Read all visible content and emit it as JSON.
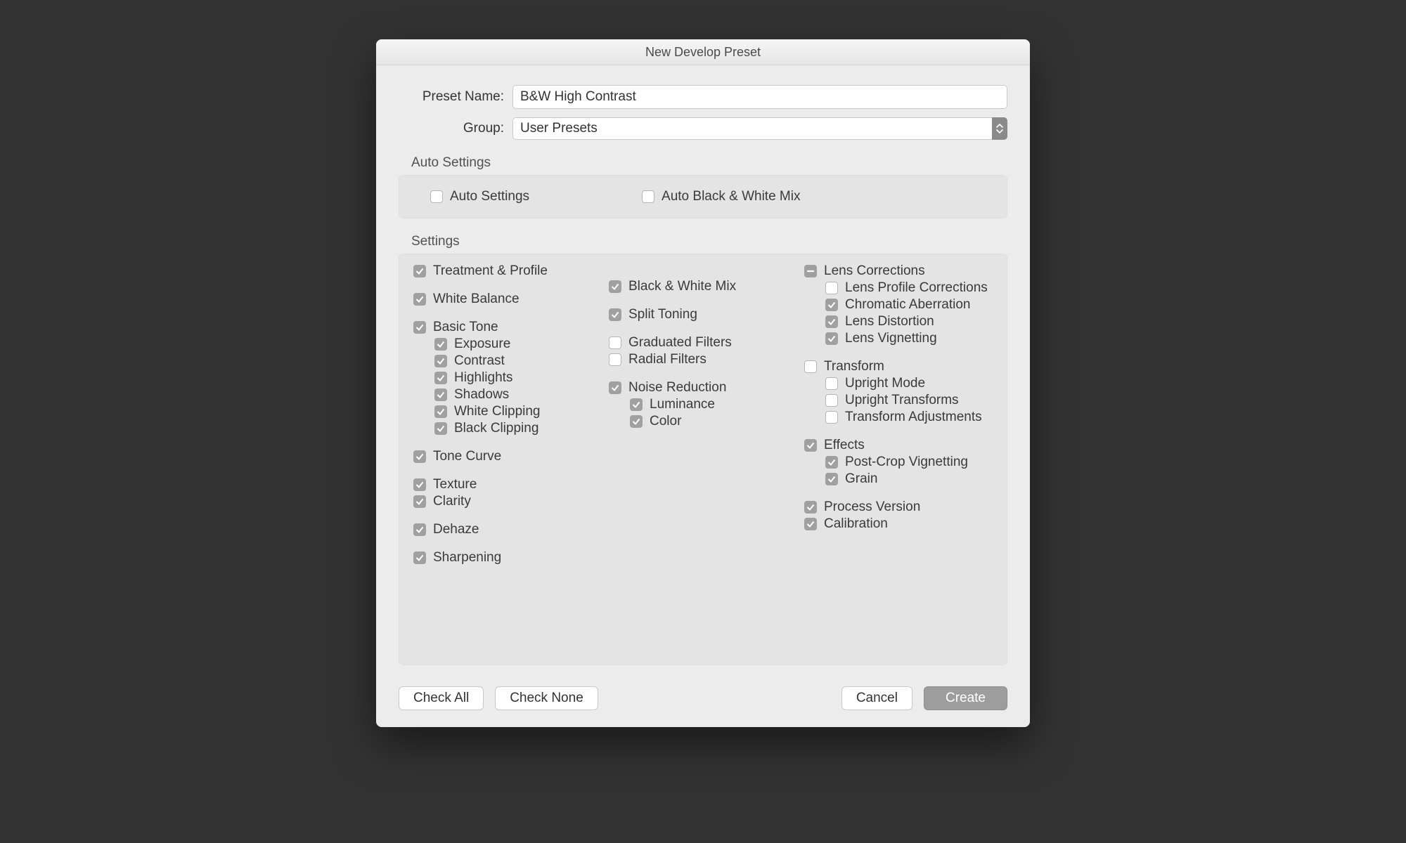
{
  "title": "New Develop Preset",
  "form": {
    "preset_name_label": "Preset Name:",
    "preset_name_value": "B&W High Contrast",
    "group_label": "Group:",
    "group_value": "User Presets"
  },
  "auto_section": {
    "header": "Auto Settings",
    "auto_settings": {
      "label": "Auto Settings",
      "checked": false
    },
    "auto_bw_mix": {
      "label": "Auto Black & White Mix",
      "checked": false
    }
  },
  "settings_section": {
    "header": "Settings"
  },
  "col1": {
    "treatment_profile": {
      "label": "Treatment & Profile",
      "checked": true
    },
    "white_balance": {
      "label": "White Balance",
      "checked": true
    },
    "basic_tone": {
      "label": "Basic Tone",
      "checked": true
    },
    "basic_tone_children": {
      "exposure": {
        "label": "Exposure",
        "checked": true
      },
      "contrast": {
        "label": "Contrast",
        "checked": true
      },
      "highlights": {
        "label": "Highlights",
        "checked": true
      },
      "shadows": {
        "label": "Shadows",
        "checked": true
      },
      "white_clipping": {
        "label": "White Clipping",
        "checked": true
      },
      "black_clipping": {
        "label": "Black Clipping",
        "checked": true
      }
    },
    "tone_curve": {
      "label": "Tone Curve",
      "checked": true
    },
    "texture": {
      "label": "Texture",
      "checked": true
    },
    "clarity": {
      "label": "Clarity",
      "checked": true
    },
    "dehaze": {
      "label": "Dehaze",
      "checked": true
    },
    "sharpening": {
      "label": "Sharpening",
      "checked": true
    }
  },
  "col2": {
    "bw_mix": {
      "label": "Black  &  White Mix",
      "checked": true
    },
    "split_toning": {
      "label": "Split Toning",
      "checked": true
    },
    "graduated_filters": {
      "label": "Graduated Filters",
      "checked": false
    },
    "radial_filters": {
      "label": "Radial Filters",
      "checked": false
    },
    "noise_reduction": {
      "label": "Noise Reduction",
      "checked": true
    },
    "noise_children": {
      "luminance": {
        "label": "Luminance",
        "checked": true
      },
      "color": {
        "label": "Color",
        "checked": true
      }
    }
  },
  "col3": {
    "lens_corrections": {
      "label": "Lens Corrections",
      "state": "mixed"
    },
    "lens_children": {
      "lens_profile": {
        "label": "Lens Profile Corrections",
        "checked": false
      },
      "chromatic": {
        "label": "Chromatic Aberration",
        "checked": true
      },
      "distortion": {
        "label": "Lens Distortion",
        "checked": true
      },
      "vignetting": {
        "label": "Lens Vignetting",
        "checked": true
      }
    },
    "transform": {
      "label": "Transform",
      "checked": false
    },
    "transform_children": {
      "upright_mode": {
        "label": "Upright Mode",
        "checked": false
      },
      "upright_transforms": {
        "label": "Upright Transforms",
        "checked": false
      },
      "transform_adjustments": {
        "label": "Transform Adjustments",
        "checked": false
      }
    },
    "effects": {
      "label": "Effects",
      "checked": true
    },
    "effects_children": {
      "post_crop_vignetting": {
        "label": "Post-Crop Vignetting",
        "checked": true
      },
      "grain": {
        "label": "Grain",
        "checked": true
      }
    },
    "process_version": {
      "label": "Process Version",
      "checked": true
    },
    "calibration": {
      "label": "Calibration",
      "checked": true
    }
  },
  "footer": {
    "check_all": "Check All",
    "check_none": "Check None",
    "cancel": "Cancel",
    "create": "Create"
  }
}
